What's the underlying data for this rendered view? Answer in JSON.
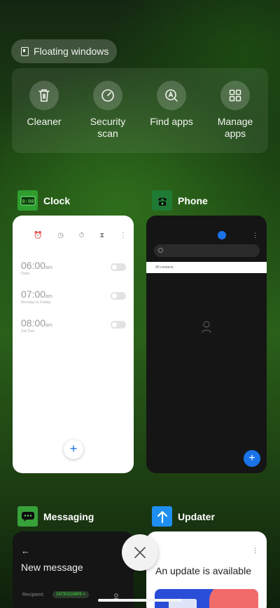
{
  "floating": {
    "label": "Floating windows"
  },
  "tools": [
    {
      "label": "Cleaner",
      "icon": "trash-icon"
    },
    {
      "label": "Security\nscan",
      "icon": "speedometer-icon"
    },
    {
      "label": "Find apps",
      "icon": "search-apps-icon"
    },
    {
      "label": "Manage\napps",
      "icon": "grid-icon"
    }
  ],
  "apps": {
    "clock": {
      "name": "Clock",
      "alarms": [
        {
          "time": "06:00",
          "ampm": "am",
          "days": "Daily"
        },
        {
          "time": "07:00",
          "ampm": "am",
          "days": "Monday to Friday"
        },
        {
          "time": "08:00",
          "ampm": "am",
          "days": "Sat Sun"
        }
      ],
      "fab": "+"
    },
    "phone": {
      "name": "Phone",
      "contacts_label": "All contacts",
      "fab": "+"
    },
    "messaging": {
      "name": "Messaging",
      "back": "←",
      "title": "New message",
      "recipient_label": "Recipient:",
      "recipient_value": "18730218809"
    },
    "updater": {
      "name": "Updater",
      "message": "An update is available"
    }
  },
  "colors": {
    "accent_blue": "#1a73e8",
    "clock_icon_bg": "#2f9e2f",
    "phone_icon_bg": "#1f7a34",
    "messaging_icon_bg": "#37a13a",
    "updater_icon_bg": "#1e8ff0"
  }
}
